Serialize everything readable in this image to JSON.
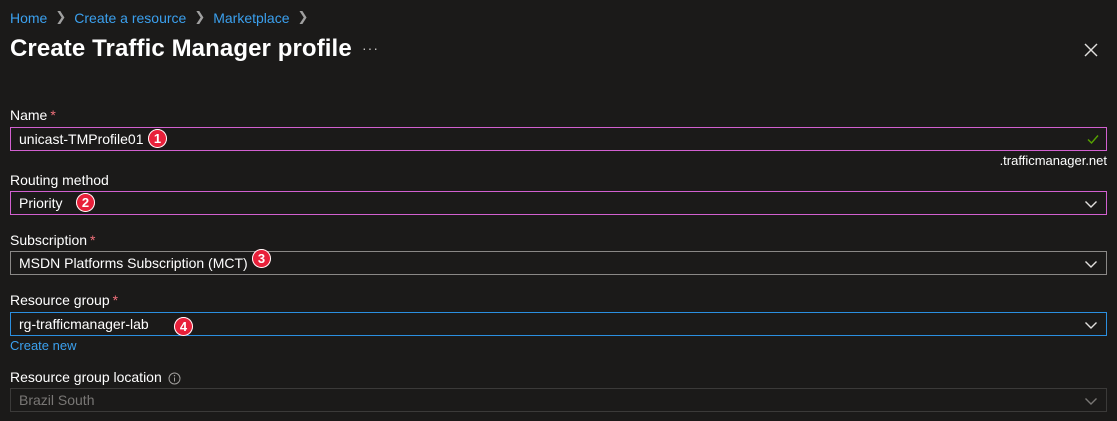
{
  "breadcrumb": {
    "items": [
      "Home",
      "Create a resource",
      "Marketplace"
    ]
  },
  "header": {
    "title": "Create Traffic Manager profile",
    "more_label": "···"
  },
  "form": {
    "name": {
      "label": "Name",
      "required": "*",
      "value": "unicast-TMProfile01",
      "suffix": ".trafficmanager.net",
      "badge": "1"
    },
    "routing_method": {
      "label": "Routing method",
      "value": "Priority",
      "badge": "2"
    },
    "subscription": {
      "label": "Subscription",
      "required": "*",
      "value": "MSDN Platforms Subscription (MCT)",
      "badge": "3"
    },
    "resource_group": {
      "label": "Resource group",
      "required": "*",
      "value": "rg-trafficmanager-lab",
      "badge": "4",
      "create_new": "Create new"
    },
    "resource_group_location": {
      "label": "Resource group location",
      "value": "Brazil South"
    }
  },
  "colors": {
    "background": "#1b1a19",
    "link": "#3ba0ee",
    "required": "#f1707b",
    "highlight_border": "#d260d0",
    "focus_border": "#2b8fe0",
    "valid_check": "#57a300",
    "badge": "#e8203a"
  },
  "icons": {
    "close": "close-icon",
    "chevron": "chevron-down-icon",
    "check": "checkmark-icon",
    "info": "info-icon",
    "breadcrumb_separator": "chevron-right-icon"
  }
}
